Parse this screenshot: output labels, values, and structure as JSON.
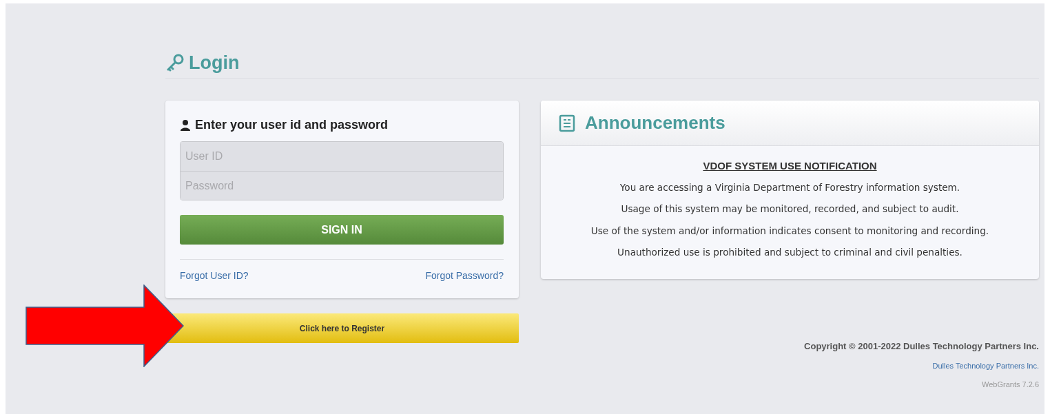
{
  "page_title": "Login",
  "login_form": {
    "title": "Enter your user id and password",
    "fields": [
      {
        "placeholder": "User ID"
      },
      {
        "placeholder": "Password"
      }
    ],
    "submit": "SIGN IN",
    "links": [
      "Forgot User ID?",
      "Forgot Password?"
    ]
  },
  "register_button": "Click here to Register",
  "announcements": {
    "title": "Announcements",
    "heading": "VDOF SYSTEM USE NOTIFICATION",
    "lines": [
      "You are accessing a Virginia Department of Forestry information system.",
      "Usage of this system may be monitored, recorded, and subject to audit.",
      "Use of the system and/or information indicates consent to monitoring and recording.",
      "Unauthorized use is prohibited and subject to criminal and civil penalties."
    ]
  },
  "footer": {
    "copyright": "Copyright © 2001-2022 Dulles Technology Partners Inc.",
    "link": "Dulles Technology Partners Inc.",
    "version": "WebGrants 7.2.6"
  }
}
